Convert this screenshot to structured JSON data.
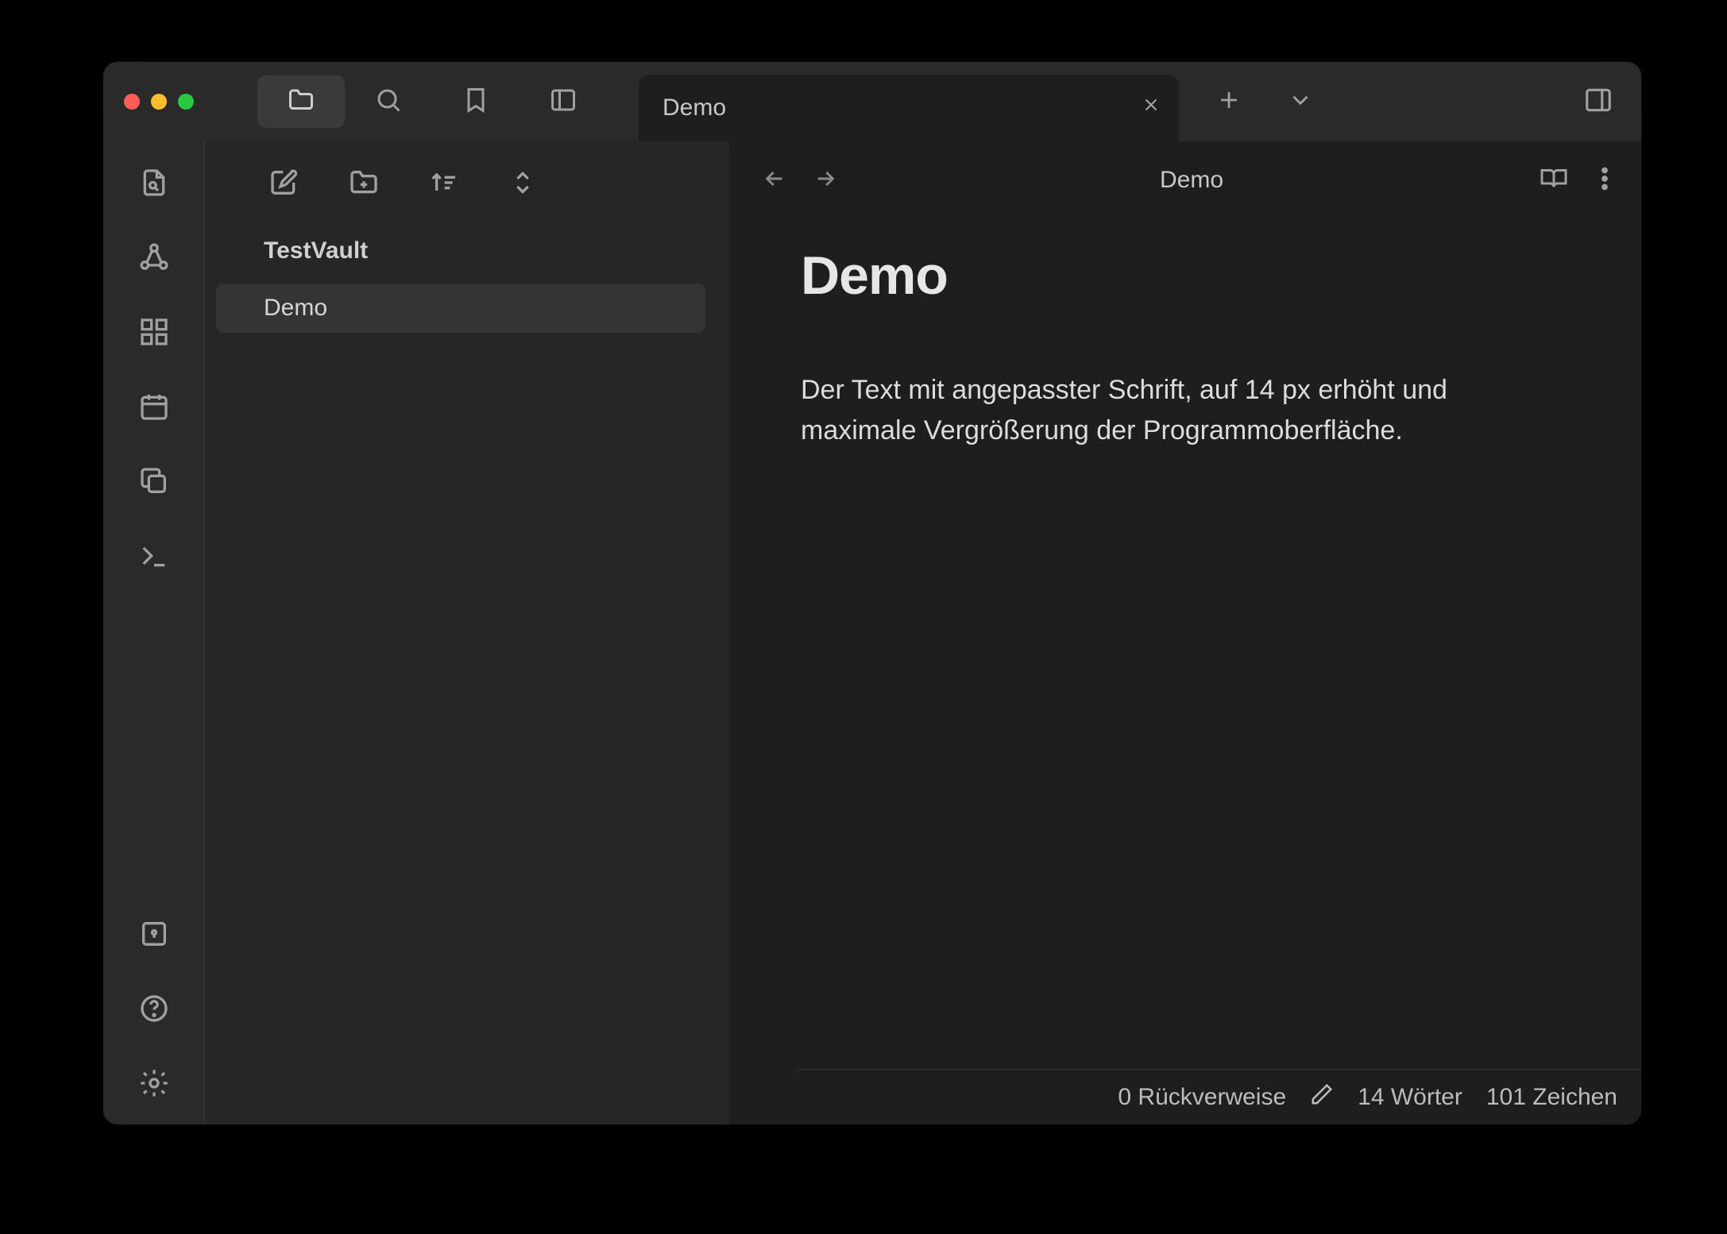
{
  "window": {
    "traffic": {
      "close": "close",
      "minimize": "minimize",
      "maximize": "maximize"
    }
  },
  "top_icons": {
    "file_explorer": "file-explorer",
    "search": "search",
    "bookmark": "bookmark",
    "panel_left": "left-panel"
  },
  "tabs": {
    "active": {
      "label": "Demo"
    }
  },
  "tab_actions": {
    "new_tab": "new-tab",
    "dropdown": "tab-dropdown",
    "right_panel": "right-panel"
  },
  "ribbon": {
    "top": [
      "quick-switcher",
      "graph-view",
      "canvas",
      "daily-note",
      "templates",
      "command-palette"
    ],
    "bottom": [
      "vault",
      "help",
      "settings"
    ]
  },
  "explorer": {
    "toolbar": [
      "new-note",
      "new-folder",
      "sort",
      "collapse"
    ],
    "vault_name": "TestVault",
    "files": [
      {
        "name": "Demo",
        "active": true
      }
    ]
  },
  "editor": {
    "nav": {
      "back": "back",
      "forward": "forward"
    },
    "title": "Demo",
    "header_icons": {
      "reading": "reading-view",
      "more": "more-options"
    },
    "heading": "Demo",
    "body": "Der Text mit angepasster Schrift, auf 14 px erhöht und maximale Vergrößerung der Programmoberfläche."
  },
  "status": {
    "backlinks": "0 Rückverweise",
    "edit_mode": "edit",
    "words": "14 Wörter",
    "chars": "101 Zeichen"
  }
}
